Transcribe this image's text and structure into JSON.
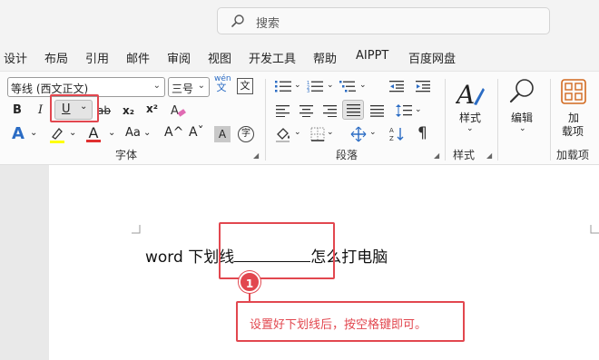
{
  "search": {
    "placeholder": "搜索"
  },
  "menu": {
    "tabs": [
      "设计",
      "布局",
      "引用",
      "邮件",
      "审阅",
      "视图",
      "开发工具",
      "帮助",
      "AIPPT",
      "百度网盘"
    ]
  },
  "font_group": {
    "font_name": "等线 (西文正文)",
    "font_size": "三号",
    "label": "字体",
    "wen_top": "wén",
    "wen_char": "文",
    "a_box": "A",
    "bold": "B",
    "italic": "I",
    "underline": "U",
    "strike": "ab",
    "subscript": "x₂",
    "superscript": "x²",
    "font_color": "A",
    "case": "Aa",
    "grow": "A^",
    "shrink": "Aˇ",
    "shade": "A",
    "phonetic": "字"
  },
  "paragraph_group": {
    "label": "段落"
  },
  "styles_group": {
    "label": "样式",
    "button": "样式"
  },
  "editing": {
    "button": "编辑"
  },
  "addins": {
    "line1": "加",
    "line2": "载项",
    "label": "加载项"
  },
  "document": {
    "before": "word 下划线",
    "after": "怎么打电脑"
  },
  "annotation": {
    "badge": "1",
    "callout": "设置好下划线后，按空格键即可。"
  },
  "colors": {
    "accent_red": "#e2474f",
    "highlight_yellow": "#ffff00",
    "font_red": "#e03030",
    "text_effects_blue": "#2b6cc4"
  }
}
